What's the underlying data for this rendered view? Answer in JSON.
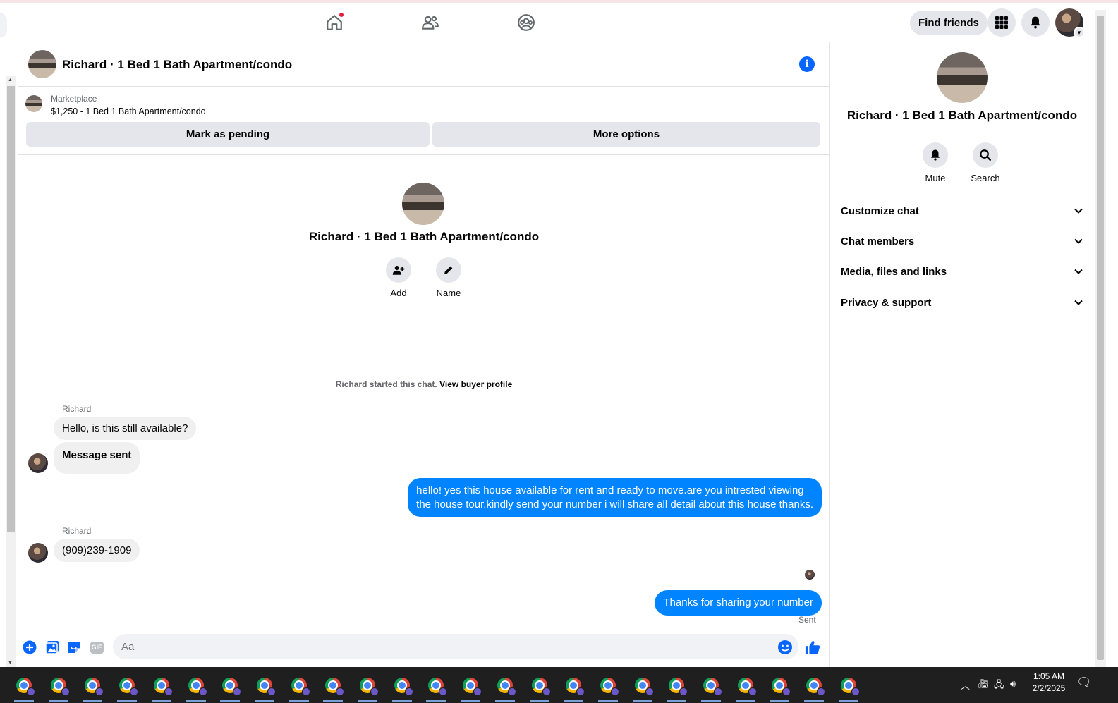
{
  "topbar": {
    "find_friends_label": "Find friends"
  },
  "chat": {
    "header_title": "Richard · 1 Bed 1 Bath Apartment/condo",
    "marketplace": {
      "label": "Marketplace",
      "listing": "$1,250 - 1 Bed 1 Bath Apartment/condo",
      "mark_pending_label": "Mark as pending",
      "more_options_label": "More options"
    },
    "profile": {
      "name": "Richard · 1 Bed 1 Bath Apartment/condo",
      "add_label": "Add",
      "name_label": "Name"
    },
    "started_text": "Richard started this chat.",
    "view_profile_link": "View buyer profile",
    "messages": [
      {
        "sender": "Richard",
        "text": "Hello, is this still available?"
      },
      {
        "text": "Message sent"
      },
      {
        "text_line1": "hello! yes this house available for rent and ready to move.are you intrested viewing",
        "text_line2": "the house tour.kindly send your number i will share all detail about this house thanks."
      },
      {
        "sender": "Richard",
        "text": "(909)239-1909"
      },
      {
        "text": "Thanks for sharing your number",
        "status": "Sent"
      }
    ],
    "composer": {
      "placeholder": "Aa",
      "gif_label": "GIF"
    }
  },
  "info_panel": {
    "name": "Richard · 1 Bed 1 Bath Apartment/condo",
    "mute_label": "Mute",
    "search_label": "Search",
    "sections": [
      "Customize chat",
      "Chat members",
      "Media, files and links",
      "Privacy & support"
    ]
  },
  "taskbar": {
    "time": "1:05 AM",
    "date": "2/2/2025"
  },
  "colors": {
    "accent": "#0084ff",
    "notification": "#e41e3f",
    "taskbar": "#1f1f1f"
  }
}
